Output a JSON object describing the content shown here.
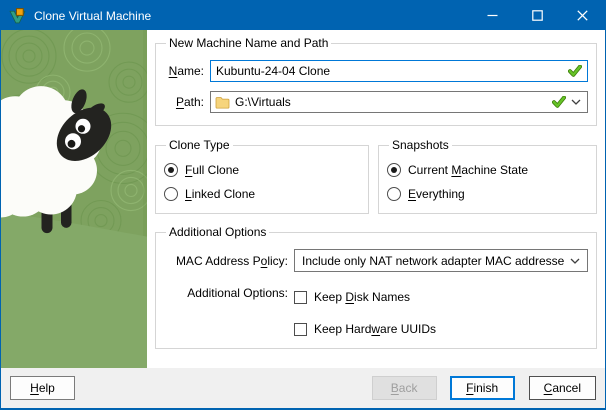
{
  "colors": {
    "accent": "#0063b1",
    "focus": "#0078d7",
    "valid": "#53b40e",
    "footer": "#f0f0f0"
  },
  "titlebar": {
    "title": "Clone Virtual Machine"
  },
  "name_path": {
    "title": "New Machine Name and Path",
    "name_label": "&Name:",
    "name_value": "Kubuntu-24-04 Clone",
    "path_label": "&Path:",
    "path_value": "G:\\Virtuals"
  },
  "clone_type": {
    "title": "Clone Type",
    "full": {
      "label": "&Full Clone",
      "selected": true
    },
    "linked": {
      "label": "&Linked Clone",
      "selected": false
    }
  },
  "snapshots": {
    "title": "Snapshots",
    "current": {
      "label": "Current &Machine State",
      "selected": true
    },
    "everything": {
      "label": "&Everything",
      "selected": false
    }
  },
  "additional": {
    "title": "Additional Options",
    "mac_label": "MAC Address P&olicy:",
    "mac_value": "Include only NAT network adapter MAC addresses",
    "options_label": "Additional Options:",
    "keep_disk": {
      "label": "Keep &Disk Names",
      "checked": false
    },
    "keep_uuid": {
      "label": "Keep Hard&ware UUIDs",
      "checked": false
    }
  },
  "footer": {
    "help": {
      "label": "&Help"
    },
    "back": {
      "label": "&Back",
      "disabled": true
    },
    "finish": {
      "label": "&Finish",
      "default": true
    },
    "cancel": {
      "label": "&Cancel"
    }
  }
}
